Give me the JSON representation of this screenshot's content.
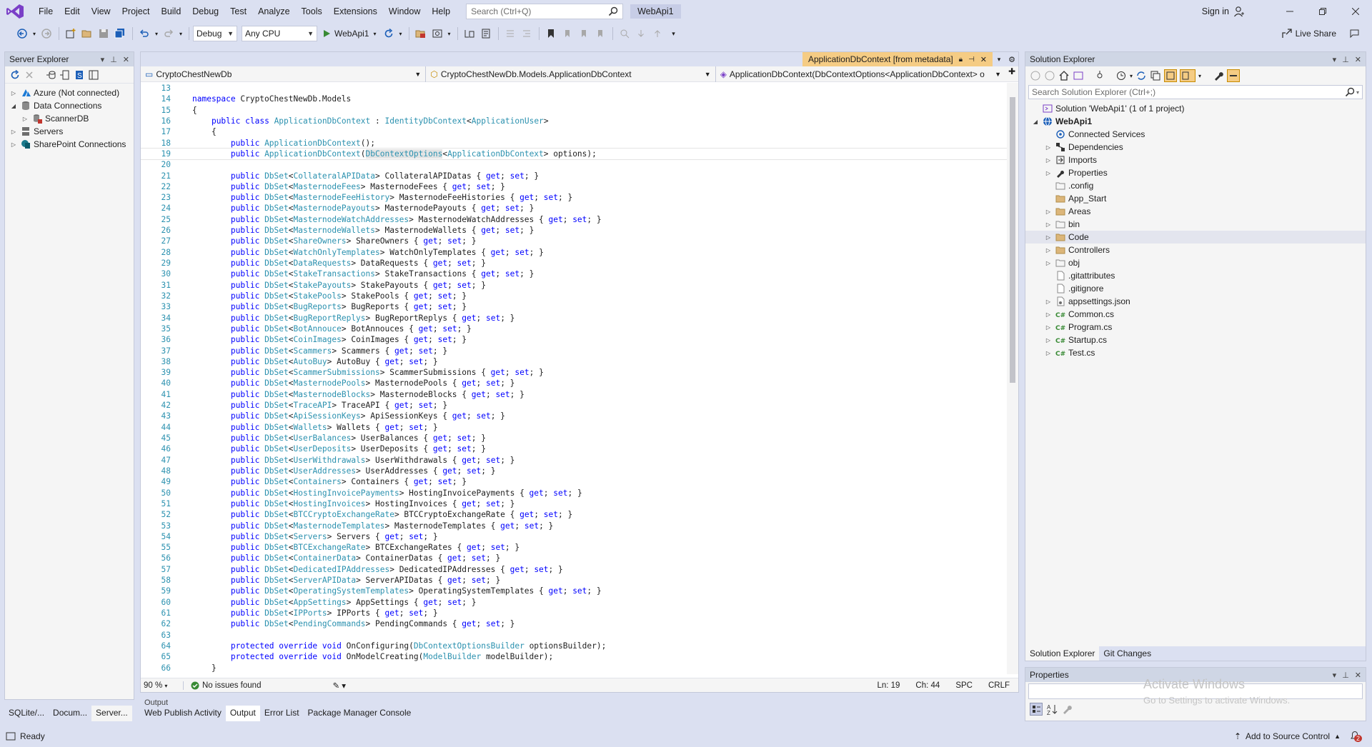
{
  "menu": [
    "File",
    "Edit",
    "View",
    "Project",
    "Build",
    "Debug",
    "Test",
    "Analyze",
    "Tools",
    "Extensions",
    "Window",
    "Help"
  ],
  "search": {
    "placeholder": "Search (Ctrl+Q)"
  },
  "solution_badge": "WebApi1",
  "sign_in": "Sign in",
  "toolbar": {
    "config": "Debug",
    "platform": "Any CPU",
    "run_target": "WebApi1",
    "live_share": "Live Share"
  },
  "server_explorer": {
    "title": "Server Explorer",
    "nodes": [
      {
        "label": "Azure (Not connected)",
        "icon": "azure-icon",
        "expander": "▷",
        "indent": 0
      },
      {
        "label": "Data Connections",
        "icon": "database-icon",
        "expander": "◢",
        "indent": 0
      },
      {
        "label": "ScannerDB",
        "icon": "db-connection-icon",
        "expander": "▷",
        "indent": 1
      },
      {
        "label": "Servers",
        "icon": "servers-icon",
        "expander": "▷",
        "indent": 0
      },
      {
        "label": "SharePoint Connections",
        "icon": "sharepoint-icon",
        "expander": "▷",
        "indent": 0
      }
    ],
    "bottom_tabs": [
      "SQLite/...",
      "Docum...",
      "Server..."
    ]
  },
  "editor": {
    "doc_tab": "ApplicationDbContext [from metadata]",
    "nav": [
      "CryptoChestNewDb",
      "CryptoChestNewDb.Models.ApplicationDbContext",
      "ApplicationDbContext(DbContextOptions<ApplicationDbContext> o"
    ],
    "zoom": "90 %",
    "issues": "No issues found",
    "position": {
      "ln": "Ln: 19",
      "ch": "Ch: 44",
      "spc": "SPC",
      "crlf": "CRLF"
    },
    "dbsets": [
      [
        "CollateralAPIData",
        "CollateralAPIDatas"
      ],
      [
        "MasternodeFees",
        "MasternodeFees"
      ],
      [
        "MasternodeFeeHistory",
        "MasternodeFeeHistories"
      ],
      [
        "MasternodePayouts",
        "MasternodePayouts"
      ],
      [
        "MasternodeWatchAddresses",
        "MasternodeWatchAddresses"
      ],
      [
        "MasternodeWallets",
        "MasternodeWallets"
      ],
      [
        "ShareOwners",
        "ShareOwners"
      ],
      [
        "WatchOnlyTemplates",
        "WatchOnlyTemplates"
      ],
      [
        "DataRequests",
        "DataRequests"
      ],
      [
        "StakeTransactions",
        "StakeTransactions"
      ],
      [
        "StakePayouts",
        "StakePayouts"
      ],
      [
        "StakePools",
        "StakePools"
      ],
      [
        "BugReports",
        "BugReports"
      ],
      [
        "BugReportReplys",
        "BugReportReplys"
      ],
      [
        "BotAnnouce",
        "BotAnnouces"
      ],
      [
        "CoinImages",
        "CoinImages"
      ],
      [
        "Scammers",
        "Scammers"
      ],
      [
        "AutoBuy",
        "AutoBuy"
      ],
      [
        "ScammerSubmissions",
        "ScammerSubmissions"
      ],
      [
        "MasternodePools",
        "MasternodePools"
      ],
      [
        "MasternodeBlocks",
        "MasternodeBlocks"
      ],
      [
        "TraceAPI",
        "TraceAPI"
      ],
      [
        "ApiSessionKeys",
        "ApiSessionKeys"
      ],
      [
        "Wallets",
        "Wallets"
      ],
      [
        "UserBalances",
        "UserBalances"
      ],
      [
        "UserDeposits",
        "UserDeposits"
      ],
      [
        "UserWithdrawals",
        "UserWithdrawals"
      ],
      [
        "UserAddresses",
        "UserAddresses"
      ],
      [
        "Containers",
        "Containers"
      ],
      [
        "HostingInvoicePayments",
        "HostingInvoicePayments"
      ],
      [
        "HostingInvoices",
        "HostingInvoices"
      ],
      [
        "BTCCryptoExchangeRate",
        "BTCCryptoExchangeRate"
      ],
      [
        "MasternodeTemplates",
        "MasternodeTemplates"
      ],
      [
        "Servers",
        "Servers"
      ],
      [
        "BTCExchangeRate",
        "BTCExchangeRates"
      ],
      [
        "ContainerData",
        "ContainerDatas"
      ],
      [
        "DedicatedIPAddresses",
        "DedicatedIPAddresses"
      ],
      [
        "ServerAPIData",
        "ServerAPIDatas"
      ],
      [
        "OperatingSystemTemplates",
        "OperatingSystemTemplates"
      ],
      [
        "AppSettings",
        "AppSettings"
      ],
      [
        "IPPorts",
        "IPPorts"
      ],
      [
        "PendingCommands",
        "PendingCommands"
      ]
    ]
  },
  "output": {
    "header": "Output",
    "tabs": [
      "Web Publish Activity",
      "Output",
      "Error List",
      "Package Manager Console"
    ]
  },
  "solution_explorer": {
    "title": "Solution Explorer",
    "search_placeholder": "Search Solution Explorer (Ctrl+;)",
    "items": [
      {
        "label": "Solution 'WebApi1' (1 of 1 project)",
        "icon": "solution-icon",
        "expander": "",
        "indent": 0,
        "bold": false
      },
      {
        "label": "WebApi1",
        "icon": "web-project-icon",
        "expander": "◢",
        "indent": 0,
        "bold": true
      },
      {
        "label": "Connected Services",
        "icon": "connected-services-icon",
        "expander": "",
        "indent": 1
      },
      {
        "label": "Dependencies",
        "icon": "dependencies-icon",
        "expander": "▷",
        "indent": 1
      },
      {
        "label": "Imports",
        "icon": "imports-icon",
        "expander": "▷",
        "indent": 1
      },
      {
        "label": "Properties",
        "icon": "properties-icon",
        "expander": "▷",
        "indent": 1
      },
      {
        "label": ".config",
        "icon": "folder-outline-icon",
        "expander": "",
        "indent": 1
      },
      {
        "label": "App_Start",
        "icon": "folder-icon",
        "expander": "",
        "indent": 1
      },
      {
        "label": "Areas",
        "icon": "folder-icon",
        "expander": "▷",
        "indent": 1
      },
      {
        "label": "bin",
        "icon": "folder-outline-icon",
        "expander": "▷",
        "indent": 1
      },
      {
        "label": "Code",
        "icon": "folder-icon",
        "expander": "▷",
        "indent": 1,
        "selected": true
      },
      {
        "label": "Controllers",
        "icon": "folder-icon",
        "expander": "▷",
        "indent": 1
      },
      {
        "label": "obj",
        "icon": "folder-outline-icon",
        "expander": "▷",
        "indent": 1
      },
      {
        "label": ".gitattributes",
        "icon": "file-icon",
        "expander": "",
        "indent": 1
      },
      {
        "label": ".gitignore",
        "icon": "file-icon",
        "expander": "",
        "indent": 1
      },
      {
        "label": "appsettings.json",
        "icon": "json-file-icon",
        "expander": "▷",
        "indent": 1
      },
      {
        "label": "Common.cs",
        "icon": "csharp-file-icon",
        "expander": "▷",
        "indent": 1
      },
      {
        "label": "Program.cs",
        "icon": "csharp-file-icon",
        "expander": "▷",
        "indent": 1
      },
      {
        "label": "Startup.cs",
        "icon": "csharp-file-icon",
        "expander": "▷",
        "indent": 1
      },
      {
        "label": "Test.cs",
        "icon": "csharp-file-icon",
        "expander": "▷",
        "indent": 1
      }
    ],
    "tabs": [
      "Solution Explorer",
      "Git Changes"
    ]
  },
  "properties": {
    "title": "Properties"
  },
  "watermark": {
    "line1": "Activate Windows",
    "line2": "Go to Settings to activate Windows."
  },
  "status": {
    "ready": "Ready",
    "source_control": "Add to Source Control",
    "notifications": "2"
  },
  "colors": {
    "keyword": "#0000ff",
    "type": "#2b91af",
    "doc_tab": "#f5cc84",
    "chrome": "#dbe0f1"
  }
}
